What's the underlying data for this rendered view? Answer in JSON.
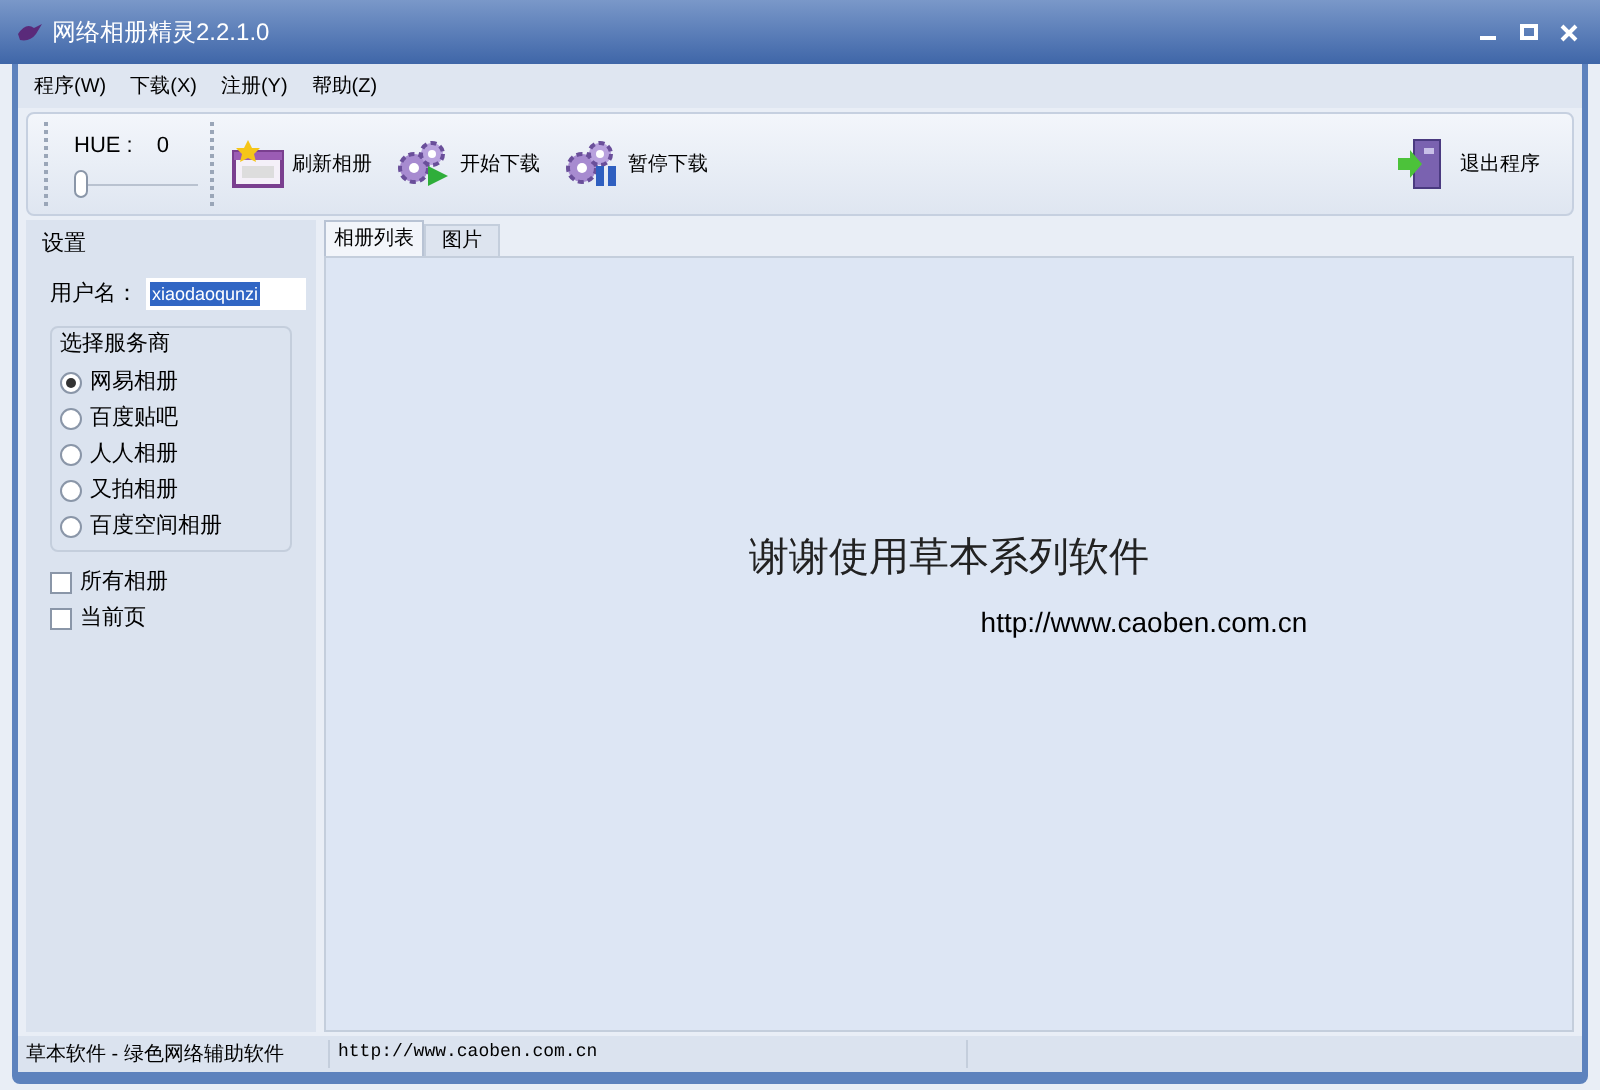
{
  "window": {
    "title": "网络相册精灵2.2.1.0"
  },
  "menu": [
    "程序(W)",
    "下载(X)",
    "注册(Y)",
    "帮助(Z)"
  ],
  "hue": {
    "label": "HUE :",
    "value": "0",
    "level": 0
  },
  "toolbar": [
    {
      "kind": "refresh",
      "label": "刷新相册"
    },
    {
      "kind": "start",
      "label": "开始下载"
    },
    {
      "kind": "pause",
      "label": "暂停下载"
    }
  ],
  "exit_button": {
    "label": "退出程序"
  },
  "settings": {
    "title": "设置",
    "username_label": "用户名：",
    "username": "xiaodaoqunzi",
    "provider_group": "选择服务商",
    "providers": [
      {
        "label": "网易相册",
        "selected": true
      },
      {
        "label": "百度贴吧",
        "selected": false
      },
      {
        "label": "人人相册",
        "selected": false
      },
      {
        "label": "又拍相册",
        "selected": false
      },
      {
        "label": "百度空间相册",
        "selected": false
      }
    ],
    "options": [
      {
        "label": "所有相册",
        "checked": false
      },
      {
        "label": "当前页",
        "checked": false
      }
    ]
  },
  "tabs": [
    {
      "label": "相册列表",
      "selected": true
    },
    {
      "label": "图片",
      "selected": false
    }
  ],
  "content": {
    "message": "谢谢使用草本系列软件",
    "url": "http://www.caoben.com.cn"
  },
  "status_bar": [
    "草本软件 - 绿色网络辅助软件",
    "http://www.caoben.com.cn"
  ]
}
